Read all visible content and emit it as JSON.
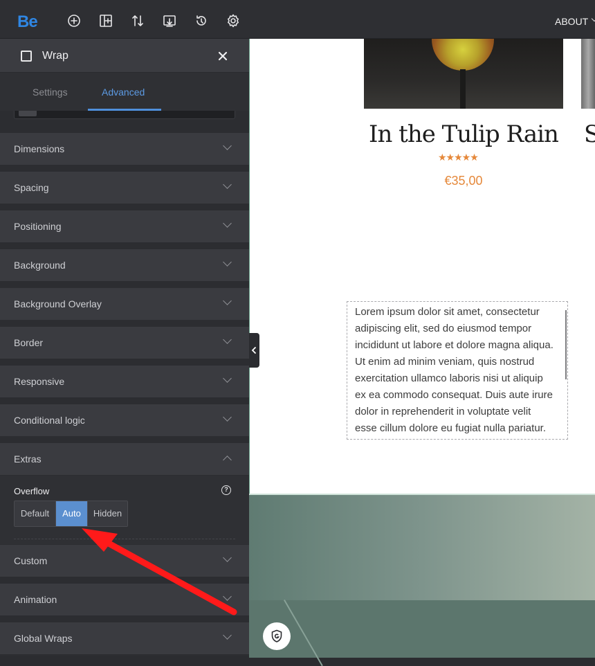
{
  "topbar": {
    "logo": "Be",
    "icons": [
      "add-icon",
      "layout-icon",
      "sort-icon",
      "import-icon",
      "history-icon",
      "settings-icon"
    ],
    "nav_item": "ABOUT"
  },
  "panel": {
    "title": "Wrap",
    "tabs": [
      {
        "label": "Settings",
        "active": false
      },
      {
        "label": "Advanced",
        "active": true
      }
    ],
    "sections": [
      {
        "label": "Dimensions",
        "expanded": false
      },
      {
        "label": "Spacing",
        "expanded": false
      },
      {
        "label": "Positioning",
        "expanded": false
      },
      {
        "label": "Background",
        "expanded": false
      },
      {
        "label": "Background Overlay",
        "expanded": false
      },
      {
        "label": "Border",
        "expanded": false
      },
      {
        "label": "Responsive",
        "expanded": false
      },
      {
        "label": "Conditional logic",
        "expanded": false
      },
      {
        "label": "Extras",
        "expanded": true
      },
      {
        "label": "Custom",
        "expanded": false
      },
      {
        "label": "Animation",
        "expanded": false
      },
      {
        "label": "Global Wraps",
        "expanded": false
      }
    ],
    "extras": {
      "overflow_label": "Overflow",
      "help_icon": "?",
      "options": [
        "Default",
        "Auto",
        "Hidden"
      ],
      "selected": "Auto"
    }
  },
  "canvas": {
    "product": {
      "title": "In the Tulip Rain",
      "next_title_fragment": "S",
      "rating": 5,
      "stars": "★★★★★",
      "price": "€35,00"
    },
    "lorem": "Lorem ipsum dolor sit amet, consectetur adipiscing elit, sed do eiusmod tempor incididunt ut labore et dolore magna aliqua. Ut enim ad minim veniam, quis nostrud exercitation ullamco laboris nisi ut aliquip ex ea commodo consequat. Duis aute irure dolor in reprehenderit in voluptate velit esse cillum dolore eu fugiat nulla pariatur."
  },
  "colors": {
    "accent": "#5b8fcf",
    "price": "#e5883a",
    "annotation_arrow": "#ff1a1a"
  }
}
